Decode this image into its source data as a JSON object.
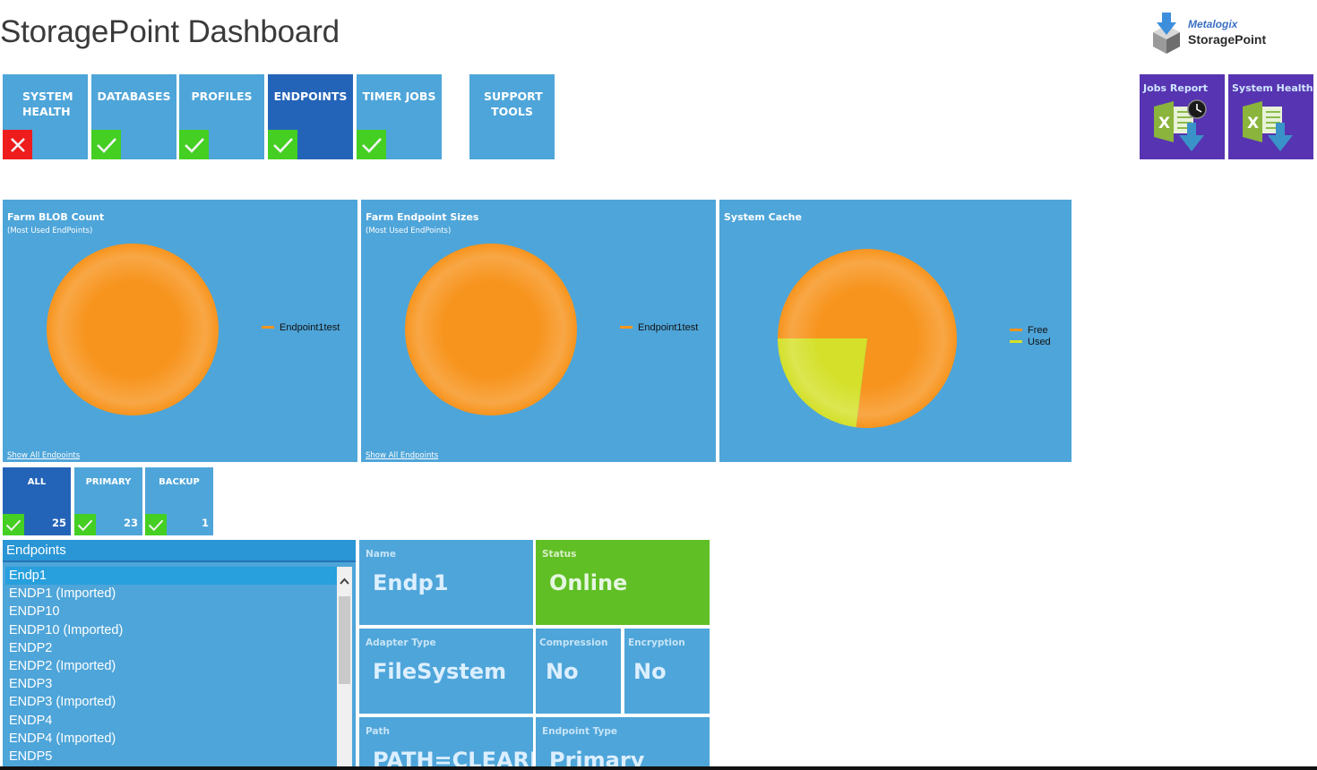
{
  "app": {
    "title": "StoragePoint Dashboard",
    "logo": {
      "brand": "Metalogix",
      "product": "StoragePoint",
      "icon": "box-download-icon"
    }
  },
  "nav_tiles": [
    {
      "label": "SYSTEM HEALTH",
      "status": "error",
      "active": false
    },
    {
      "label": "DATABASES",
      "status": "ok",
      "active": false
    },
    {
      "label": "PROFILES",
      "status": "ok",
      "active": false
    },
    {
      "label": "ENDPOINTS",
      "status": "ok",
      "active": true
    },
    {
      "label": "TIMER JOBS",
      "status": "ok",
      "active": false
    },
    {
      "label": "SUPPORT TOOLS",
      "status": null,
      "active": false
    }
  ],
  "reports": [
    {
      "label": "Jobs Report",
      "icon": "excel-download-clock-icon"
    },
    {
      "label": "System Health",
      "icon": "excel-download-icon"
    }
  ],
  "panels": [
    {
      "title": "Farm BLOB Count",
      "subtitle": "(Most Used EndPoints)",
      "link": "Show All Endpoints"
    },
    {
      "title": "Farm Endpoint Sizes",
      "subtitle": "(Most Used EndPoints)",
      "link": "Show All Endpoints"
    },
    {
      "title": "System Cache",
      "subtitle": "",
      "link": ""
    }
  ],
  "chart_data": [
    {
      "type": "pie",
      "title": "Farm BLOB Count",
      "subtitle": "(Most Used EndPoints)",
      "categories": [
        "Endpoint1test"
      ],
      "values": [
        100
      ],
      "colors": [
        "#f7941d"
      ],
      "legend": "right"
    },
    {
      "type": "pie",
      "title": "Farm Endpoint Sizes",
      "subtitle": "(Most Used EndPoints)",
      "categories": [
        "Endpoint1test"
      ],
      "values": [
        100
      ],
      "colors": [
        "#f7941d"
      ],
      "legend": "right"
    },
    {
      "type": "pie",
      "title": "System Cache",
      "categories": [
        "Free",
        "Used"
      ],
      "values": [
        77,
        23
      ],
      "colors": [
        "#f7941d",
        "#d4e02a"
      ],
      "legend": "right"
    }
  ],
  "filter_tiles": [
    {
      "label": "ALL",
      "count": "25",
      "active": true
    },
    {
      "label": "PRIMARY",
      "count": "23",
      "active": false
    },
    {
      "label": "BACKUP",
      "count": "1",
      "active": false
    }
  ],
  "endpoints": {
    "header": "Endpoints",
    "selected": "Endp1",
    "items": [
      "Endp1",
      "ENDP1 (Imported)",
      "ENDP10",
      "ENDP10 (Imported)",
      "ENDP2",
      "ENDP2 (Imported)",
      "ENDP3",
      "ENDP3 (Imported)",
      "ENDP4",
      "ENDP4 (Imported)",
      "ENDP5"
    ]
  },
  "details": {
    "name": {
      "label": "Name",
      "value": "Endp1"
    },
    "status": {
      "label": "Status",
      "value": "Online",
      "color": "#60bf24"
    },
    "adapter_type": {
      "label": "Adapter Type",
      "value": "FileSystem"
    },
    "compression": {
      "label": "Compression",
      "value": "No"
    },
    "encryption": {
      "label": "Encryption",
      "value": "No"
    },
    "path": {
      "label": "Path",
      "value": "PATH=CLEARE"
    },
    "endpoint_type": {
      "label": "Endpoint Type",
      "value": "Primary"
    }
  },
  "colors": {
    "tile": "#4ea5d9",
    "tile_active": "#2464b8",
    "ok": "#44cf22",
    "error": "#ee1c1c",
    "report": "#5734b1"
  }
}
